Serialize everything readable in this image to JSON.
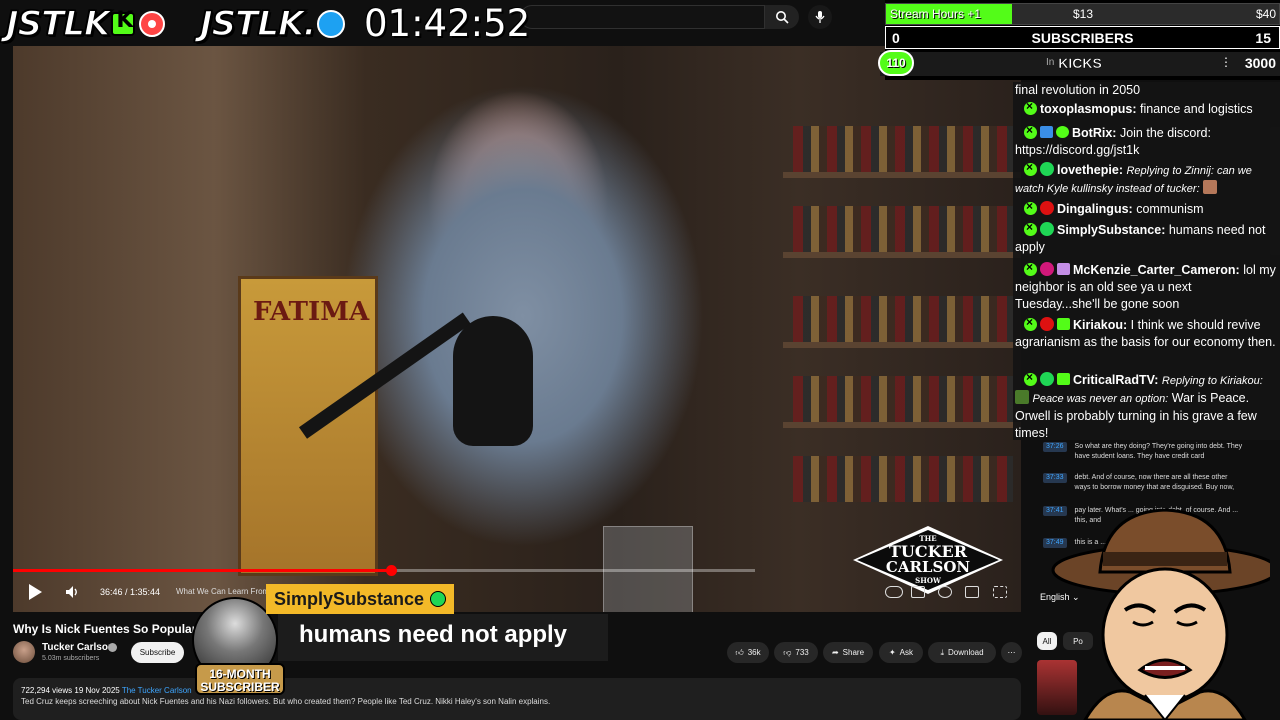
{
  "overlay": {
    "brand_left": "JSTLK",
    "brand_right": "JSTLK.",
    "clock": "01:42:52"
  },
  "stats": {
    "hours_label": "Stream Hours +1",
    "hours_progress": 0.32,
    "hours_mid": "$13",
    "hours_max": "$40",
    "subs_min": "0",
    "subs_label": "SUBSCRIBERS",
    "subs_max": "15",
    "kicks_count": "110",
    "kicks_in": "In",
    "kicks_label": "KICKS",
    "kicks_dots": "⋮",
    "kicks_max": "3000"
  },
  "video": {
    "sign_text": "FATIMA",
    "logo": {
      "the": "THE",
      "line1": "TUCKER",
      "line2": "CARLSON",
      "show": "SHOW"
    },
    "progress": 0.51,
    "time_text": "36:46 / 1:35:44",
    "chapter_text": "What We Can Learn From t",
    "title": "Why Is Nick Fuentes So Popular? N",
    "channel_name": "Tucker Carlson",
    "subscribers": "5.03m subscribers",
    "subscribe_label": "Subscribe",
    "likes": "36k",
    "dislikes": "733",
    "share_label": "Share",
    "ask_label": "Ask",
    "download_label": "Download",
    "more_label": "⋯",
    "meta_stats": "722,294 views  19 Nov 2025",
    "meta_link": "The Tucker Carlson",
    "description": "Ted Cruz keeps screeching about Nick Fuentes and his Nazi followers. But who created them? People like Ted Cruz. Nikki Haley's son Nalin explains."
  },
  "alert": {
    "username": "SimplySubstance",
    "message": "humans need not apply",
    "badge_line1": "16-MONTH",
    "badge_line2": "SUBSCRIBER"
  },
  "chat": [
    {
      "user": "",
      "text": "final revolution in 2050"
    },
    {
      "user": "toxoplasmopus:",
      "text": "finance and logistics"
    },
    {
      "user": "BotRix:",
      "text": "Join the discord: https://discord.gg/jst1k"
    },
    {
      "user": "lovethepie:",
      "reply": "Replying to Zinnij: can we watch Kyle kullinsky instead of tucker:",
      "text": ""
    },
    {
      "user": "Dingalingus:",
      "text": "communism"
    },
    {
      "user": "SimplySubstance:",
      "text": "humans need not apply"
    },
    {
      "user": "McKenzie_Carter_Cameron:",
      "text": "lol my neighbor is an old see ya u next Tuesday...she'll be gone soon"
    },
    {
      "user": "Kiriakou:",
      "text": "I think we should revive agrarianism as the basis for our economy then."
    },
    {
      "user": "CriticalRadTV:",
      "reply": "Replying to Kiriakou:",
      "reply2": "Peace was never an option:",
      "text": "War is Peace. Orwell is probably turning in his grave a few times!"
    }
  ],
  "transcript": [
    {
      "time": "37:26",
      "text": "So what are they doing? They're going into debt. They have student loans. They have credit card"
    },
    {
      "time": "37:33",
      "text": "debt. And of course, now there are all these other ways to borrow money that are disguised. Buy now,"
    },
    {
      "time": "37:41",
      "text": "pay later. What's ... going into debt, of course. And ... this, and"
    },
    {
      "time": "37:49",
      "text": "this is a ... exclusiv"
    }
  ],
  "sidebar": {
    "language": "English",
    "chip_all": "All",
    "chip_po": "Po"
  },
  "colors": {
    "kick_green": "#53fc18",
    "yt_red": "#ff0000",
    "alert_gold": "#f3b928"
  }
}
